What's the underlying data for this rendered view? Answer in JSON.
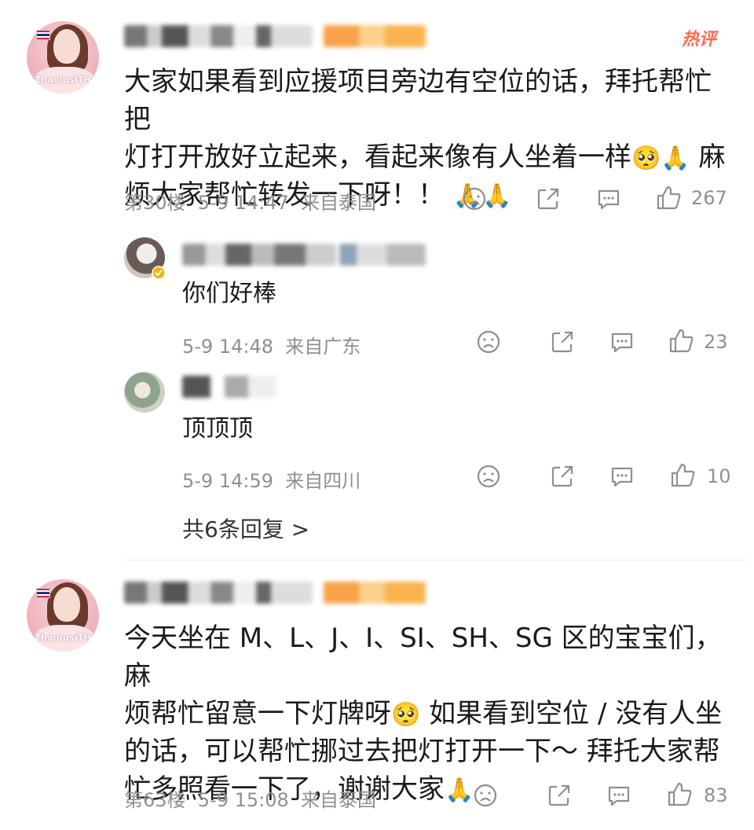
{
  "comments": [
    {
      "hot_badge": "热评",
      "avatar_watermark": "ZhaolusiTH",
      "text": [
        "大家如果看到应援项目旁边有空位的话，拜托帮忙把",
        "灯打开放好立起来，看起来像有人坐着一样",
        "烦大家帮忙转发一下呀！！"
      ],
      "text_line2_tail": "麻",
      "emoji_pleading": "🥺",
      "emoji_pray": "🙏",
      "meta": "第30楼  5-9 14:47  来自泰国",
      "likes": "267",
      "replies": [
        {
          "text": "你们好棒",
          "meta": "5-9 14:48  来自广东",
          "likes": "23"
        },
        {
          "text": "顶顶顶",
          "meta": "5-9 14:59  来自四川",
          "likes": "10"
        }
      ],
      "more_replies": "共6条回复 >"
    },
    {
      "avatar_watermark": "ZhaolusiTH",
      "text": [
        "今天坐在 M、L、J、I、SI、SH、SG 区的宝宝们，麻",
        "烦帮忙留意一下灯牌呀",
        "的话，可以帮忙挪过去把灯打开一下～ 拜托大家帮",
        "忙多照看一下了，谢谢大家"
      ],
      "text_line2_tail": "如果看到空位 / 没有人坐",
      "meta": "第63楼  5-9 15:08  来自泰国",
      "likes": "83"
    }
  ],
  "icons": [
    "sad-face-icon",
    "share-icon",
    "comment-icon",
    "like-icon",
    "verified-badge-icon",
    "thai-flag-icon"
  ],
  "colors": {
    "hot": "#ff6a4d",
    "meta": "#8f8f8f",
    "text": "#1a1a1a"
  }
}
